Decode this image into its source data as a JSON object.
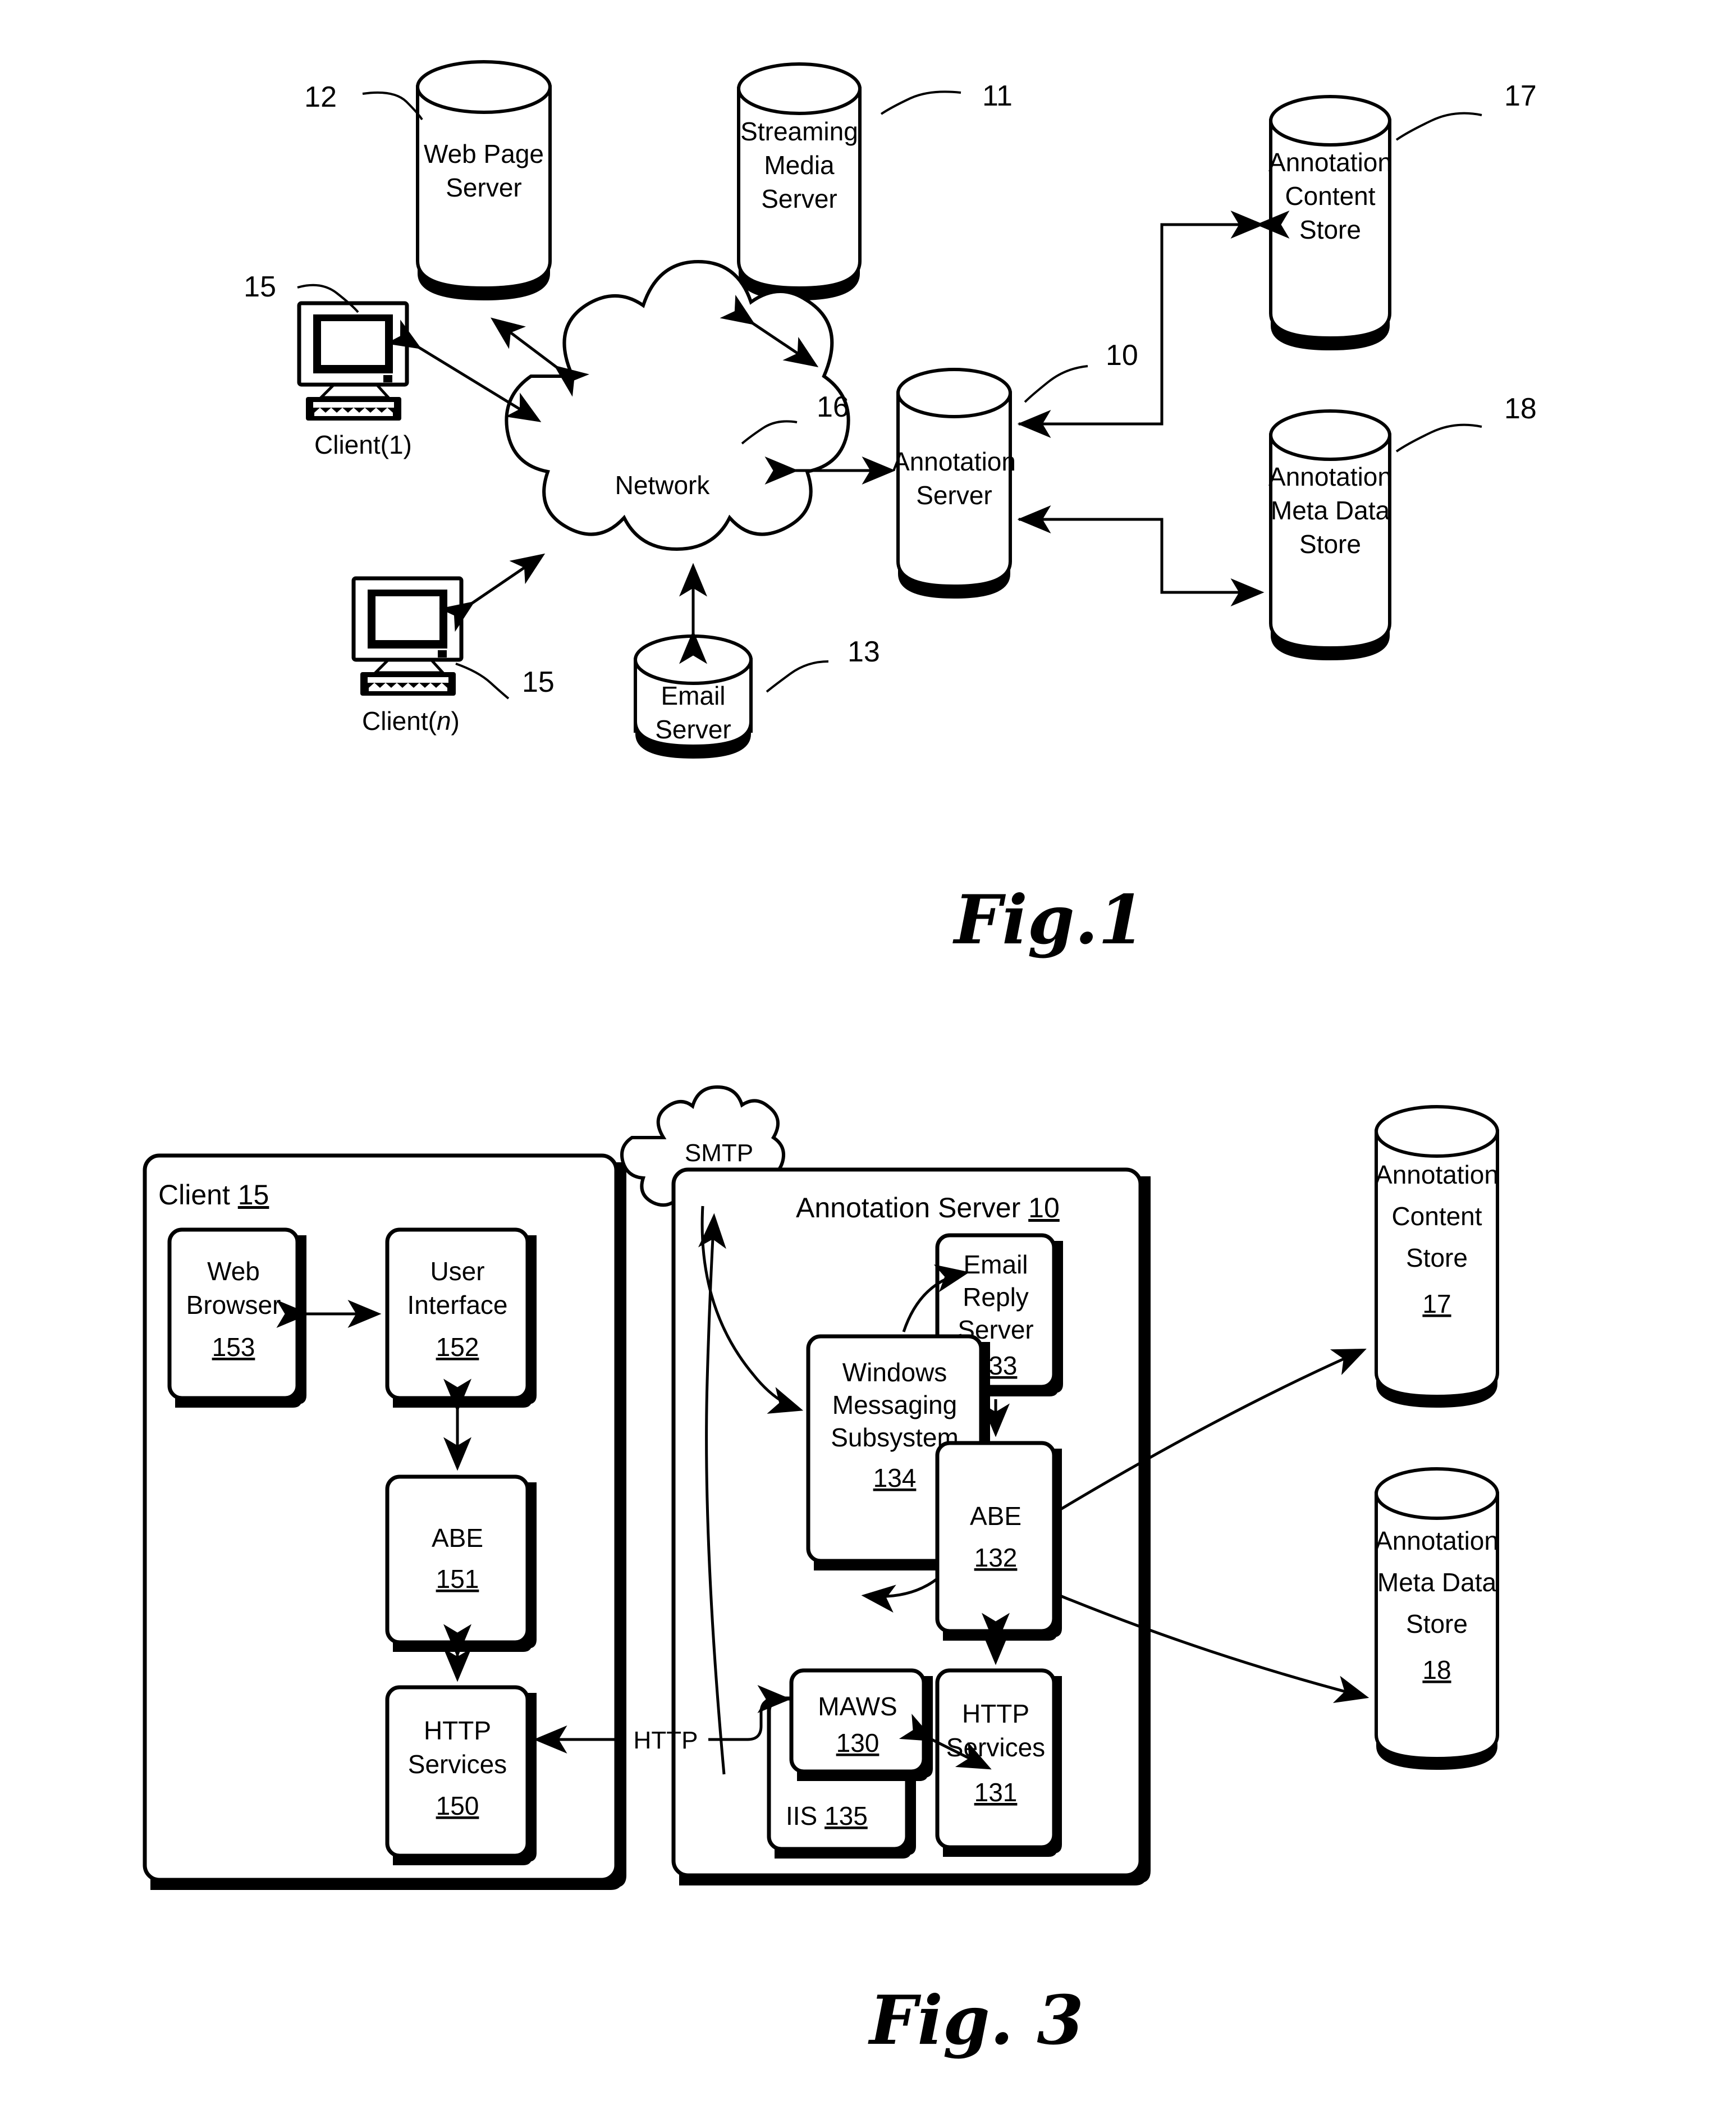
{
  "figure1": {
    "caption": "Fig.1",
    "nodes": {
      "web_page_server": {
        "line1": "Web Page",
        "line2": "Server",
        "ref": "12"
      },
      "streaming_media_server": {
        "line1": "Streaming",
        "line2": "Media",
        "line3": "Server",
        "ref": "11"
      },
      "annotation_content_store": {
        "line1": "Annotation",
        "line2": "Content",
        "line3": "Store",
        "ref": "17"
      },
      "annotation_meta_data_store": {
        "line1": "Annotation",
        "line2": "Meta Data",
        "line3": "Store",
        "ref": "18"
      },
      "annotation_server": {
        "line1": "Annotation",
        "line2": "Server",
        "ref": "10"
      },
      "email_server": {
        "line1": "Email",
        "line2": "Server",
        "ref": "13"
      },
      "network": {
        "label": "Network",
        "ref": "16"
      },
      "client_1": {
        "label_pre": "Client(",
        "label_italic": "1",
        "label_post": ")",
        "ref": "15"
      },
      "client_n": {
        "label_pre": "Client(",
        "label_italic": "n",
        "label_post": ")",
        "ref": "15"
      }
    }
  },
  "figure3": {
    "caption": "Fig. 3",
    "client_group": {
      "title_text": "Client",
      "title_ref": "15",
      "boxes": [
        {
          "line1": "Web",
          "line2": "Browser",
          "ref": "153"
        },
        {
          "line1": "User",
          "line2": "Interface",
          "ref": "152"
        },
        {
          "line1": "ABE",
          "ref": "151"
        },
        {
          "line1": "HTTP",
          "line2": "Services",
          "ref": "150"
        }
      ]
    },
    "server_group": {
      "title_text": "Annotation Server",
      "title_ref": "10",
      "boxes": [
        {
          "line1": "Email",
          "line2": "Reply",
          "line3": "Server",
          "ref": "133"
        },
        {
          "line1": "Windows",
          "line2": "Messaging",
          "line3": "Subsystem",
          "ref": "134"
        },
        {
          "line1": "ABE",
          "ref": "132"
        },
        {
          "line1": "MAWS",
          "ref": "130"
        },
        {
          "line1": "IIS",
          "ref": "135"
        },
        {
          "line1": "HTTP",
          "line2": "Services",
          "ref": "131"
        }
      ]
    },
    "smtp_cloud": {
      "label": "SMTP"
    },
    "http_link": {
      "label": "HTTP"
    },
    "stores": [
      {
        "line1": "Annotation",
        "line2": "Content",
        "line3": "Store",
        "ref": "17"
      },
      {
        "line1": "Annotation",
        "line2": "Meta Data",
        "line3": "Store",
        "ref": "18"
      }
    ]
  }
}
